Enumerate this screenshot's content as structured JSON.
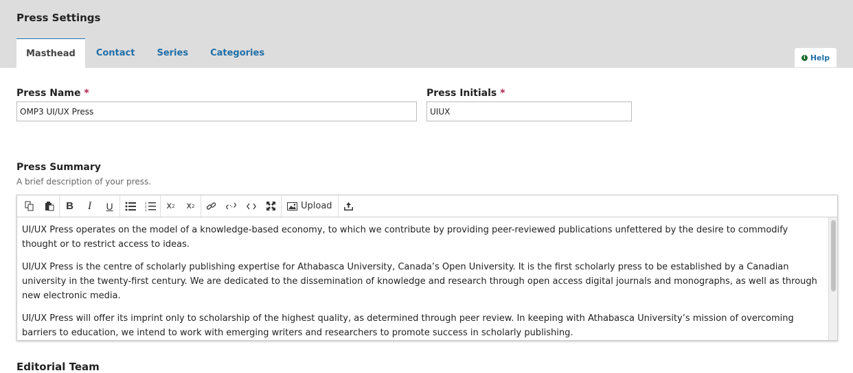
{
  "page": {
    "title": "Press Settings"
  },
  "tabs": [
    {
      "label": "Masthead",
      "active": true
    },
    {
      "label": "Contact"
    },
    {
      "label": "Series"
    },
    {
      "label": "Categories"
    }
  ],
  "help": {
    "label": "Help",
    "icon": "info-icon"
  },
  "fields": {
    "press_name": {
      "label": "Press Name",
      "required_mark": "*",
      "value": "OMP3 UI/UX Press"
    },
    "press_initials": {
      "label": "Press Initials",
      "required_mark": "*",
      "value": "UIUX"
    }
  },
  "summary": {
    "label": "Press Summary",
    "description": "A brief description of your press.",
    "toolbar": {
      "upload_label": "Upload",
      "icons": [
        "copy-icon",
        "paste-icon",
        "bold-icon",
        "italic-icon",
        "underline-icon",
        "bullet-list-icon",
        "numbered-list-icon",
        "superscript-icon",
        "subscript-icon",
        "link-icon",
        "unlink-icon",
        "code-icon",
        "fullscreen-icon",
        "image-icon",
        "upload-icon"
      ]
    },
    "paragraphs": [
      "UI/UX Press operates on the model of a knowledge-based economy, to which we contribute by providing peer-reviewed publications unfettered by the desire to commodify thought or to restrict access to ideas.",
      "UI/UX Press is the centre of scholarly publishing expertise for Athabasca University, Canada’s Open University. It is the first scholarly press to be established by a Canadian university in the twenty-first century. We are dedicated to the dissemination of knowledge and research through open access digital journals and monographs, as well as through new electronic media.",
      "UI/UX Press will offer its imprint only to scholarship of the highest quality, as determined through peer review. In keeping with Athabasca University’s mission of overcoming barriers to education, we intend to work with emerging writers and researchers to promote success in scholarly publishing."
    ]
  },
  "next_section": {
    "label": "Editorial Team"
  },
  "colors": {
    "accent": "#1f6fa8",
    "required": "#b0234a",
    "header_bg": "#dddddd"
  }
}
